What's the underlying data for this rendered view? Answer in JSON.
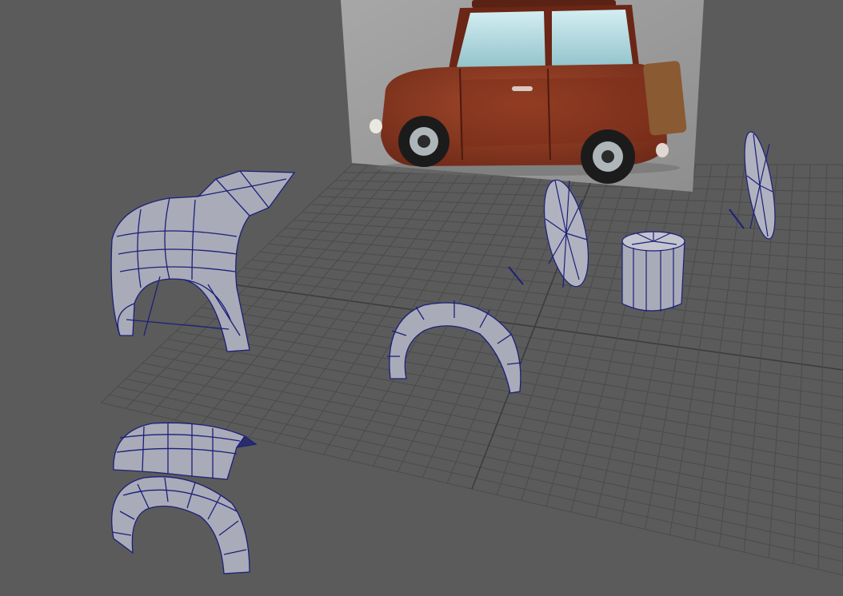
{
  "viewport": {
    "name": "3d-modeling-viewport",
    "background": "#5b5b5b",
    "grid_color": "#4a4a4a",
    "grid_axis_color": "#3a3a3a",
    "mesh_fill": "#a9abb8",
    "mesh_wire": "#1c1f7a",
    "reference_image": {
      "subject": "red cartoon car",
      "body_color": "#8f3a22",
      "window_color": "#b9dde3",
      "backdrop_color": "#9a9a9a"
    },
    "objects": [
      "rear-fender-mesh",
      "wheel-arch-mesh",
      "wheel-disc-mesh",
      "cylinder-mesh",
      "wheel-disc-far-mesh",
      "front-fender-top-mesh",
      "front-wheel-arch-mesh"
    ]
  }
}
